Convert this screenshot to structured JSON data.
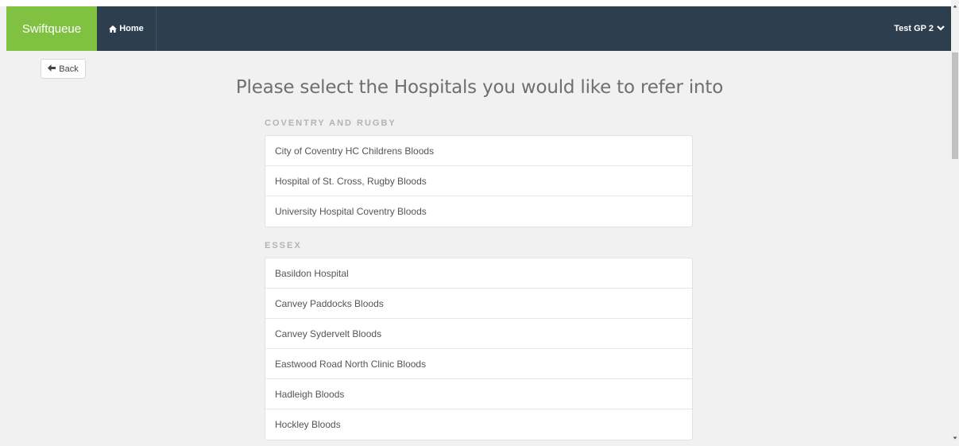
{
  "header": {
    "brand": "Swiftqueue",
    "home_label": "Home",
    "user_label": "Test GP 2",
    "icons": {
      "home": "home-icon",
      "user_menu": "chevron-down-icon"
    }
  },
  "back_button": {
    "label": "Back",
    "icon": "arrow-left-icon"
  },
  "page_title": "Please select the Hospitals you would like to refer into",
  "regions": [
    {
      "name": "COVENTRY AND RUGBY",
      "hospitals": [
        "City of Coventry HC Childrens Bloods",
        "Hospital of St. Cross, Rugby Bloods",
        "University Hospital Coventry Bloods"
      ]
    },
    {
      "name": "ESSEX",
      "hospitals": [
        "Basildon Hospital",
        "Canvey Paddocks Bloods",
        "Canvey Sydervelt Bloods",
        "Eastwood Road North Clinic Bloods",
        "Hadleigh Bloods",
        "Hockley Bloods"
      ]
    }
  ],
  "colors": {
    "brand_green": "#80c142",
    "navbar": "#2d3e4f",
    "background": "#f1f1f1"
  }
}
